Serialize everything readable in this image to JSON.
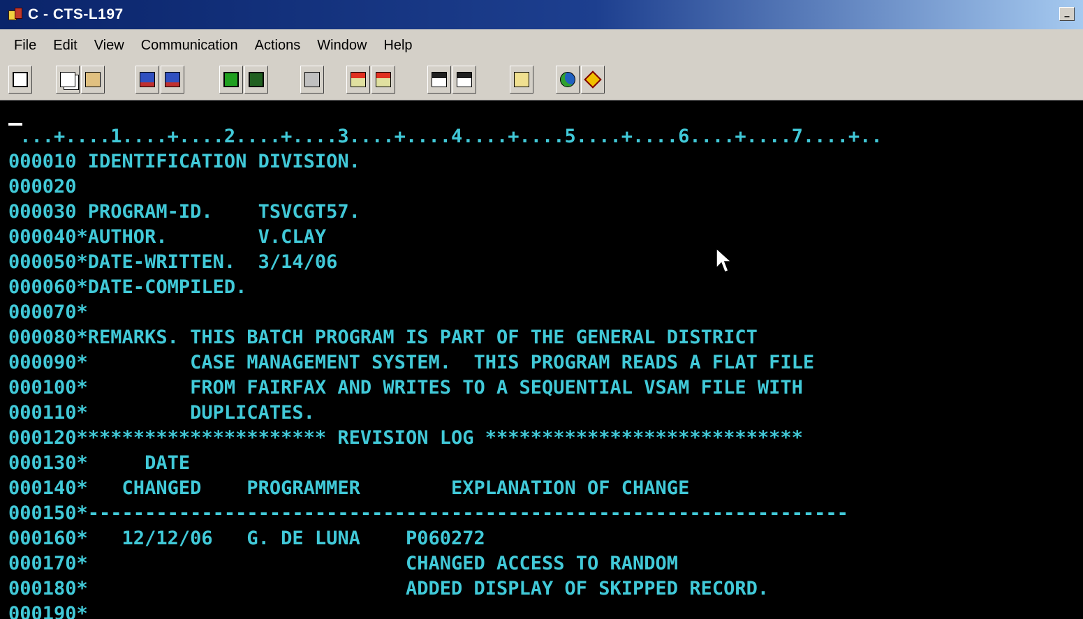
{
  "window": {
    "title": "C - CTS-L197",
    "minimize_label": "_"
  },
  "menu": [
    "File",
    "Edit",
    "View",
    "Communication",
    "Actions",
    "Window",
    "Help"
  ],
  "toolbar": {
    "buttons": [
      {
        "icon": "display-session-icon",
        "glyph": "g-screen"
      },
      {
        "icon": "copy-icon",
        "glyph": "g-copy"
      },
      {
        "icon": "paste-icon",
        "glyph": "g-paste"
      },
      {
        "icon": "send-file-icon",
        "glyph": "g-pc"
      },
      {
        "icon": "receive-file-icon",
        "glyph": "g-pc"
      },
      {
        "icon": "display-icon",
        "glyph": "g-term"
      },
      {
        "icon": "host-session-icon",
        "glyph": "g-dark"
      },
      {
        "icon": "keyboard-map-icon",
        "glyph": "g-kbd"
      },
      {
        "icon": "record-macro-icon",
        "glyph": "g-rec"
      },
      {
        "icon": "stop-macro-icon",
        "glyph": "g-rec"
      },
      {
        "icon": "play-macro-icon",
        "glyph": "g-play"
      },
      {
        "icon": "macro-list-icon",
        "glyph": "g-play"
      },
      {
        "icon": "clipboard-icon",
        "glyph": "g-clip"
      },
      {
        "icon": "globe-icon",
        "glyph": "g-globe"
      },
      {
        "icon": "help-icon",
        "glyph": "g-diamond"
      }
    ]
  },
  "terminal": {
    "text_color": "#41c9d8",
    "background": "#000000",
    "lines": [
      " ...+....1....+....2....+....3....+....4....+....5....+....6....+....7....+..",
      "000010 IDENTIFICATION DIVISION.",
      "000020",
      "000030 PROGRAM-ID.    TSVCGT57.",
      "000040*AUTHOR.        V.CLAY",
      "000050*DATE-WRITTEN.  3/14/06",
      "000060*DATE-COMPILED.",
      "000070*",
      "000080*REMARKS. THIS BATCH PROGRAM IS PART OF THE GENERAL DISTRICT",
      "000090*         CASE MANAGEMENT SYSTEM.  THIS PROGRAM READS A FLAT FILE",
      "000100*         FROM FAIRFAX AND WRITES TO A SEQUENTIAL VSAM FILE WITH",
      "000110*         DUPLICATES.",
      "000120********************** REVISION LOG ****************************",
      "000130*     DATE",
      "000140*   CHANGED    PROGRAMMER        EXPLANATION OF CHANGE",
      "000150*-------------------------------------------------------------------",
      "000160*   12/12/06   G. DE LUNA    P060272",
      "000170*                            CHANGED ACCESS TO RANDOM",
      "000180*                            ADDED DISPLAY OF SKIPPED RECORD.",
      "000190*"
    ]
  }
}
